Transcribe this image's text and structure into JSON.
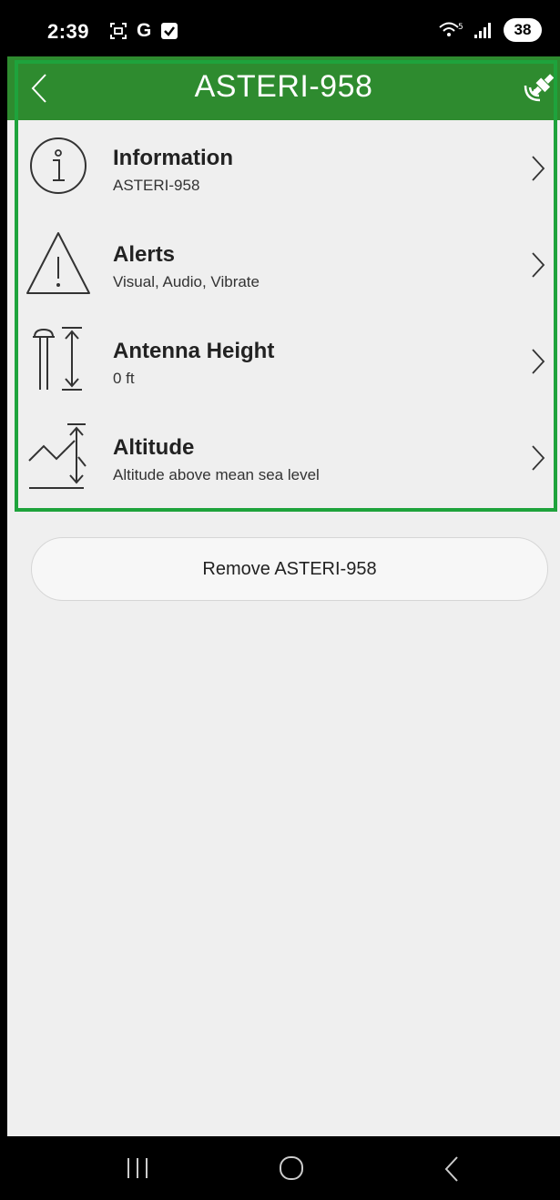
{
  "status_bar": {
    "time": "2:39",
    "left_icons": [
      "screenshot-icon",
      "google-icon",
      "checkbox-icon"
    ],
    "left_g_letter": "G",
    "signal_label": "5",
    "battery_level": "38"
  },
  "header": {
    "title": "ASTERI-958",
    "back_icon": "chevron-left-icon",
    "right_icon": "satellite-gps-icon",
    "background_color": "#2e8b2f",
    "highlight_color": "#1ea33c"
  },
  "settings": {
    "items": [
      {
        "title": "Information",
        "subtitle": "ASTERI-958",
        "icon": "info-icon"
      },
      {
        "title": "Alerts",
        "subtitle": "Visual, Audio, Vibrate",
        "icon": "warning-icon"
      },
      {
        "title": "Antenna Height",
        "subtitle": "0 ft",
        "icon": "antenna-height-icon"
      },
      {
        "title": "Altitude",
        "subtitle": "Altitude above mean sea level",
        "icon": "altitude-icon"
      }
    ]
  },
  "actions": {
    "remove_label": "Remove ASTERI-958"
  },
  "nav_bar": {
    "icons": [
      "recents-icon",
      "home-icon",
      "back-icon"
    ]
  }
}
